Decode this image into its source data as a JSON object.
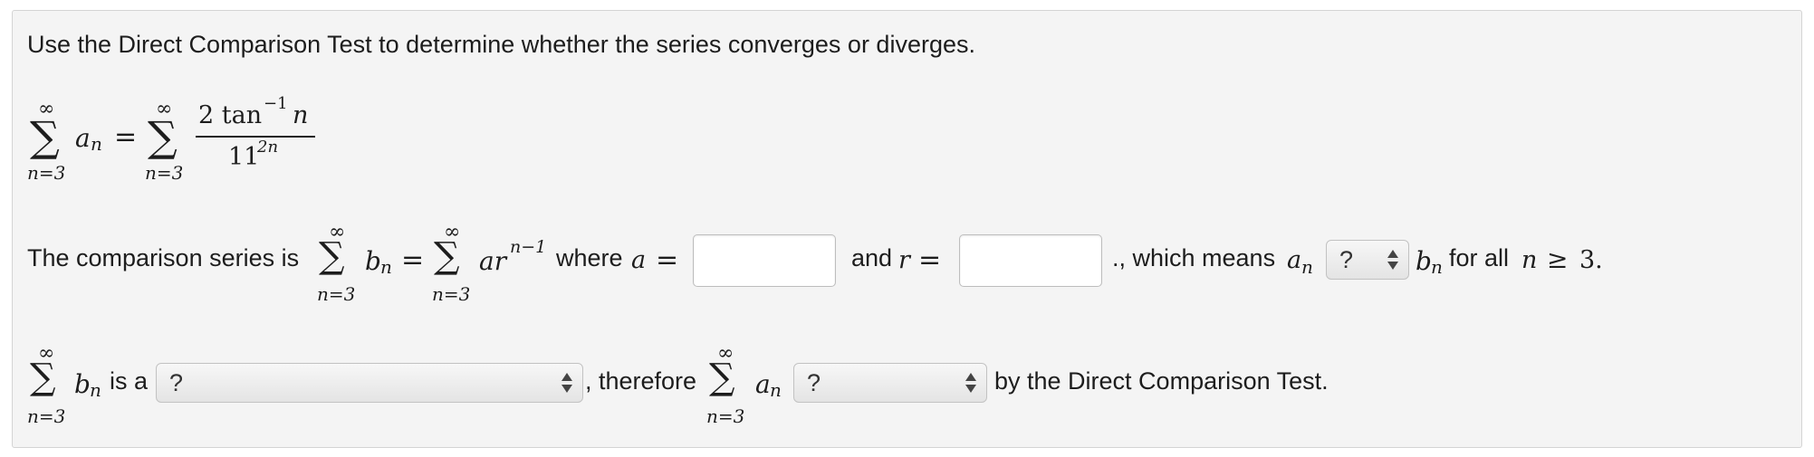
{
  "instruction": "Use the Direct Comparison Test to determine whether the series converges or diverges.",
  "given_series": {
    "sum_upper": "∞",
    "sum_lower": "n=3",
    "term_a": "a",
    "term_a_sub": "n",
    "equals": "=",
    "numerator": "2 tan",
    "numerator_sup": "−1",
    "numerator_var": "n",
    "denominator_base": "11",
    "denominator_exp": "2n"
  },
  "comparison_line": {
    "lead_text": "The comparison series is",
    "b_term": "b",
    "b_sub": "n",
    "geom_term": "ar",
    "geom_exp": "n−1",
    "where_text": "where",
    "a_var": "a",
    "a_input_value": "",
    "and_text": "and",
    "r_var": "r",
    "r_input_value": "",
    "means_text": "., which means",
    "an_var": "a",
    "an_sub": "n",
    "relation_select": "?",
    "bn_var": "b",
    "bn_sub": "n",
    "for_all_text": "for all",
    "n_var": "n",
    "geq": "≥",
    "bound": "3."
  },
  "conclusion_line": {
    "b_term": "b",
    "b_sub": "n",
    "is_a_text": "is a",
    "series_type_select": "?",
    "therefore_text": ", therefore",
    "a_term": "a",
    "a_sub": "n",
    "conclusion_select": "?",
    "by_text": "by the Direct Comparison Test."
  }
}
